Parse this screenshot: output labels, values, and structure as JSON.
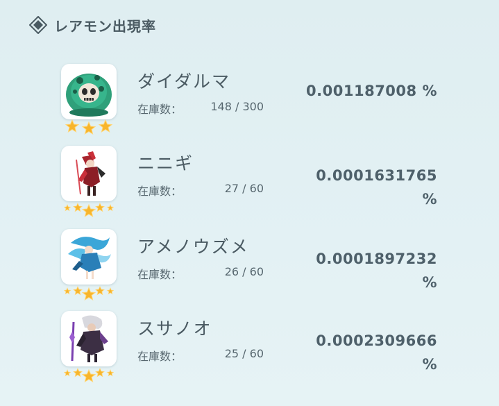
{
  "header": {
    "icon": "diamond-icon",
    "title": "レアモン出現率"
  },
  "colors": {
    "star_fill": "#f7b52c",
    "star_outline": "#ffd77a",
    "text_primary": "#4a5a62",
    "background": "#e1eff2"
  },
  "monsters": [
    {
      "name": "ダイダルマ",
      "stock_label": "在庫数：",
      "stock": "148 / 300",
      "rate_line1": "0.001187008 %",
      "rate_line2": "",
      "stars": 3,
      "icon": "daruma-monster-icon"
    },
    {
      "name": "ニニギ",
      "stock_label": "在庫数：",
      "stock": "27 / 60",
      "rate_line1": "0.0001631765",
      "rate_line2": "%",
      "stars": 5,
      "icon": "ninigi-monster-icon"
    },
    {
      "name": "アメノウズメ",
      "stock_label": "在庫数：",
      "stock": "26 / 60",
      "rate_line1": "0.0001897232",
      "rate_line2": "%",
      "stars": 5,
      "icon": "amenouzume-monster-icon"
    },
    {
      "name": "スサノオ",
      "stock_label": "在庫数：",
      "stock": "25 / 60",
      "rate_line1": "0.0002309666",
      "rate_line2": "%",
      "stars": 5,
      "icon": "susanoo-monster-icon"
    }
  ]
}
